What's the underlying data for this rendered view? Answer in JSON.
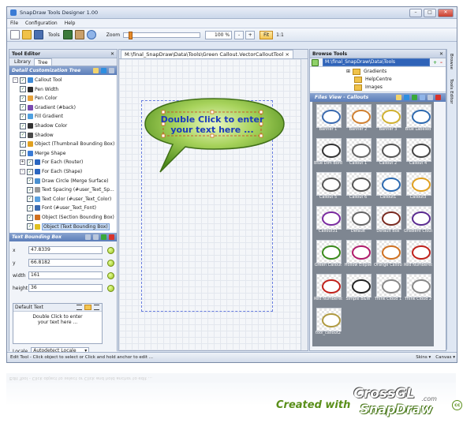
{
  "window": {
    "title": "SnapDraw Tools Designer 1.00"
  },
  "menu": [
    "File",
    "Configuration",
    "Help"
  ],
  "toolbar": {
    "tools_label": "Tools",
    "zoom_label": "Zoom",
    "zoom_value": "100 %",
    "minus": "-",
    "plus": "+",
    "fit": "Fit",
    "one_to_one": "1:1",
    "zoom_slider_fraction": 0.06
  },
  "tool_editor": {
    "title": "Tool Editor",
    "close": "✕",
    "tabs": [
      "Library",
      "Tree"
    ],
    "active_tab": "Tree",
    "tree_bar": "Detail Customization Tree",
    "tree": [
      {
        "label": "Callout Tool"
      },
      {
        "label": "Pen Width"
      },
      {
        "label": "Pen Color"
      },
      {
        "label": "Gradient (#back)"
      },
      {
        "label": "Fill Gradient"
      },
      {
        "label": "Shadow Color"
      },
      {
        "label": "Shadow"
      },
      {
        "label": "Object (Thumbnail Bounding Box)"
      },
      {
        "label": "Merge Shape"
      },
      {
        "label": "For Each (Router)"
      },
      {
        "label": "For Each (Shape)"
      },
      {
        "label": "Draw Circle (Merge Surface)"
      },
      {
        "label": "Text Spacing (#user_Text_Sp..."
      },
      {
        "label": "Text Color (#user_Text_Color)"
      },
      {
        "label": "Font (#user_Text_Font)"
      },
      {
        "label": "Object (Section Bounding Box)"
      },
      {
        "label": "Object (Text Bounding Box)"
      }
    ],
    "bounding_bar": "Text Bounding Box",
    "props": [
      {
        "key": "x",
        "value": "47.8339"
      },
      {
        "key": "y",
        "value": "66.8182"
      },
      {
        "key": "width",
        "value": "161"
      },
      {
        "key": "height",
        "value": "36"
      }
    ],
    "default_text_label": "Default Text",
    "default_text": "Double Click to enter\nyour text here ...",
    "locale_label": "Locale",
    "locale_value": "Autodetect Locale"
  },
  "document": {
    "tab": "M:\\final_SnapDraw\\Data\\Tools\\Green Callout.VectorCalloutTool",
    "tab_close": "×",
    "callout_text_1": "Double Click to enter",
    "callout_text_2": "your text here ..."
  },
  "browse": {
    "title": "Browse Tools",
    "close": "✕",
    "path": "M:\\final_SnapDraw\\Data\\Tools",
    "folders": [
      "Gradients",
      "HelpCentre",
      "Images"
    ],
    "files_bar": "Files View - Callouts",
    "thumbnails": [
      "Banner 1",
      "Banner 2",
      "Banner 3",
      "Blue Labeled",
      "Blue Dim Border",
      "Callout 1",
      "Callout 2",
      "Callout 4",
      "Callout 5",
      "Callout 6",
      "Callout1",
      "Callout3",
      "Callout31",
      "Default",
      "Default Box",
      "Gradient Cloud",
      "Green Callout",
      "Hollow Ellipse",
      "Orange Callout",
      "Red Numbered",
      "Red Numbered 2",
      "Simple B&W",
      "Think Cloud 1",
      "Think Cloud 2",
      "tool_callout2"
    ]
  },
  "sidebar": {
    "browse": "Browse",
    "tools_editor": "Tools Editor"
  },
  "status": {
    "text": "Edit Tool - Click object to select or Click and hold anchor to edit ...",
    "skins": "Skins",
    "canvas": "Canvas"
  },
  "branding": {
    "created_with": "Created with",
    "crossgl": "CrossGL",
    "com": ".com",
    "snapdraw": "SnapDraw",
    "cc": "cc"
  }
}
